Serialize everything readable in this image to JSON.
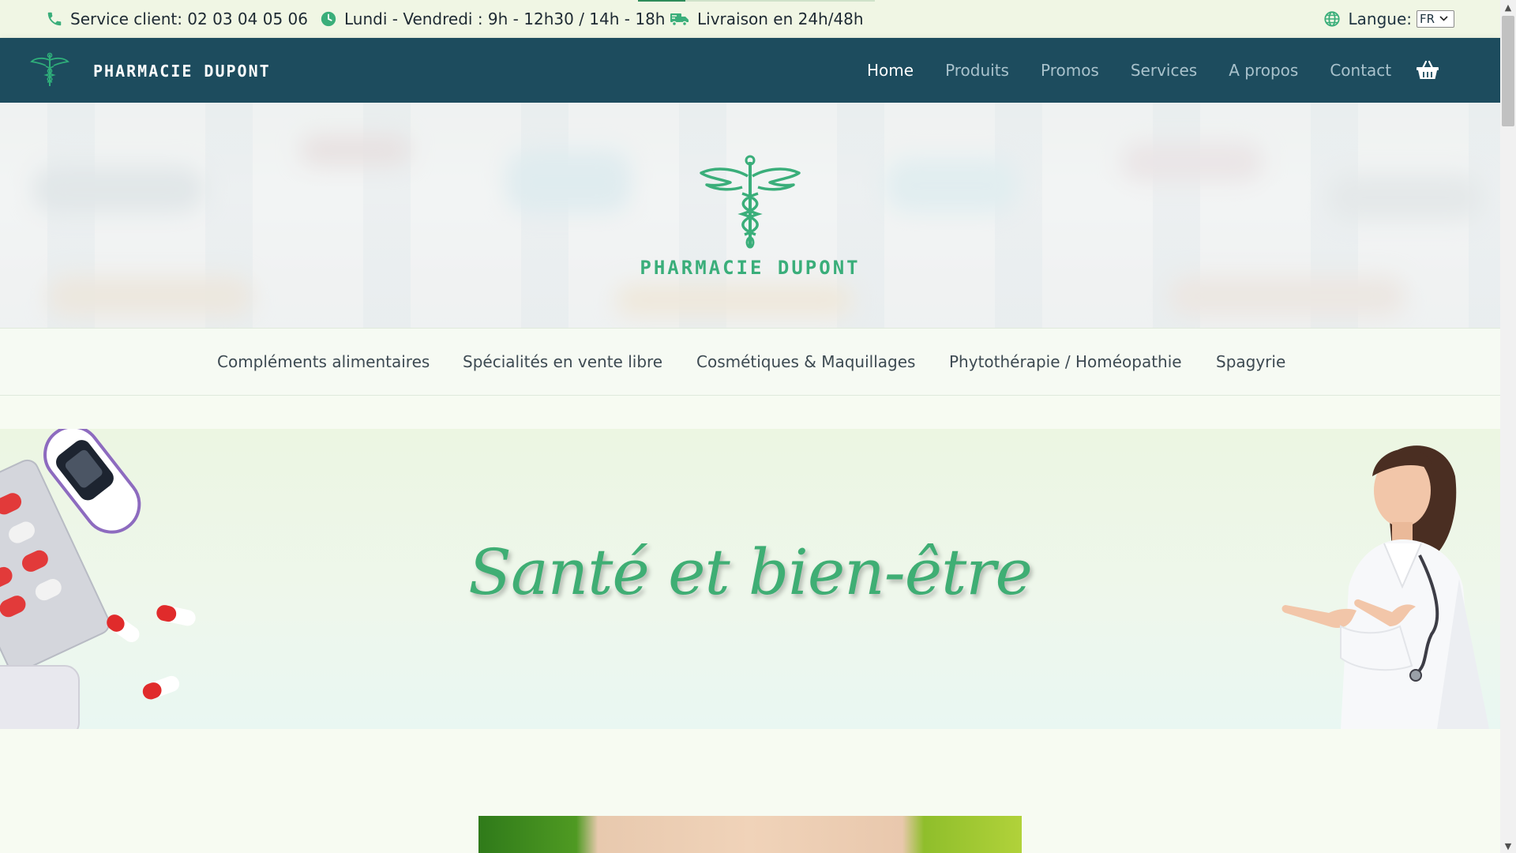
{
  "topbar": {
    "phone_text": "Service client: 02 03 04 05 06",
    "hours_text": "Lundi - Vendredi : 9h - 12h30 / 14h - 18h",
    "delivery_text": "Livraison en 24h/48h",
    "language_label": "Langue:",
    "language_value": "FR",
    "icons": [
      "phone-icon",
      "clock-icon",
      "truck-icon",
      "globe-icon",
      "chevron-down-icon"
    ]
  },
  "nav": {
    "brand": "PHARMACIE DUPONT",
    "items": [
      {
        "label": "Home",
        "active": true
      },
      {
        "label": "Produits",
        "active": false
      },
      {
        "label": "Promos",
        "active": false
      },
      {
        "label": "Services",
        "active": false
      },
      {
        "label": "A propos",
        "active": false
      },
      {
        "label": "Contact",
        "active": false
      }
    ],
    "cart_icon": "basket-icon"
  },
  "hero": {
    "brand": "PHARMACIE DUPONT",
    "logo_icon": "caduceus-icon"
  },
  "categories": [
    "Compléments alimentaires",
    "Spécialités en vente libre",
    "Cosmétiques & Maquillages",
    "Phytothérapie / Homéopathie",
    "Spagyrie"
  ],
  "banner": {
    "headline": "Santé et bien-être"
  },
  "colors": {
    "nav_bg": "#1d4c5e",
    "accent_green": "#3fae74",
    "topbar_bg": "#f0f6e4"
  }
}
